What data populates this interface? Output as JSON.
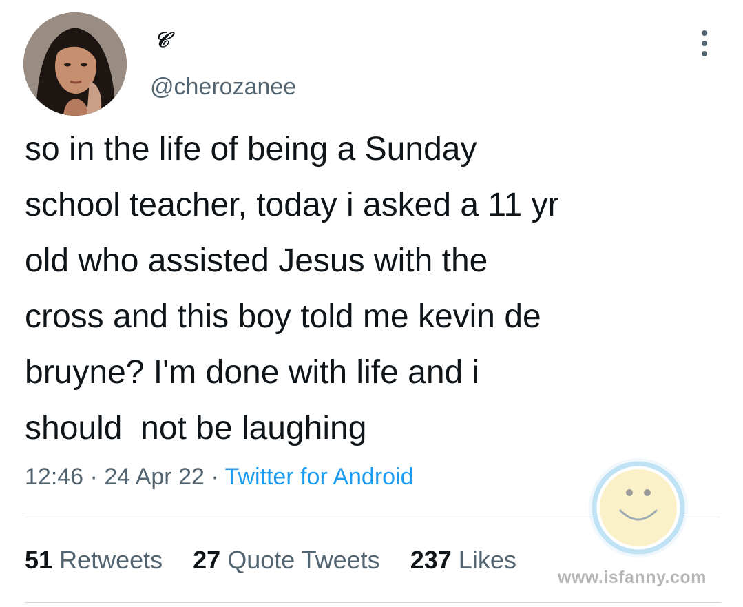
{
  "user": {
    "display_name": "𝒞",
    "handle": "@cherozanee"
  },
  "tweet": {
    "text": "so in the life of being a Sunday\nschool teacher, today i asked a 11 yr\nold who assisted Jesus with the\ncross and this boy told me kevin de\nbruyne? I'm done with life and i\nshould  not be laughing"
  },
  "meta": {
    "time": "12:46",
    "separator": "·",
    "date": "24 Apr 22",
    "source": "Twitter for Android"
  },
  "stats": {
    "retweets_count": "51",
    "retweets_label": "Retweets",
    "quotes_count": "27",
    "quotes_label": "Quote Tweets",
    "likes_count": "237",
    "likes_label": "Likes"
  },
  "watermark": {
    "text": "www.isfanny.com"
  },
  "colors": {
    "text": "#0f1419",
    "secondary": "#536471",
    "accent": "#1d9bf0",
    "divider": "#cfd9de"
  }
}
